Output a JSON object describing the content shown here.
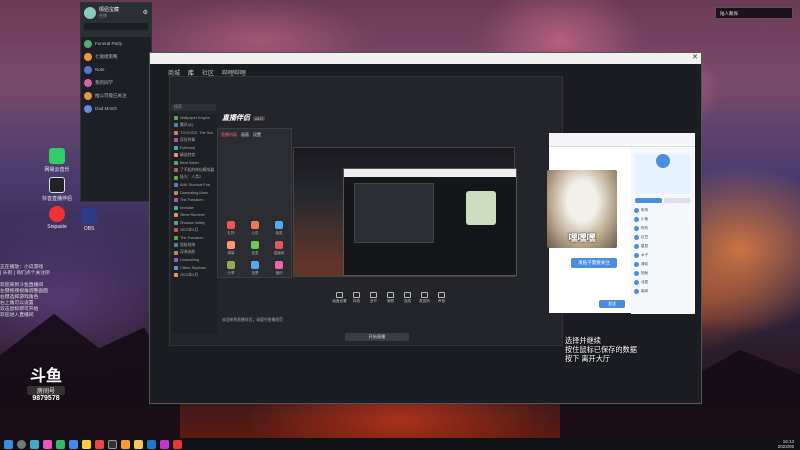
{
  "desktop": {
    "top_right_badge": "陆人聚探",
    "icons": [
      {
        "label": "网易云音乐",
        "color": "#3c6"
      },
      {
        "label": "抖音直播伴侣",
        "color": "#222"
      },
      {
        "label": "Snipaste",
        "color": "#e33"
      },
      {
        "label": "OBS",
        "color": "#2a3c8a"
      }
    ]
  },
  "qq_panel": {
    "user": "情侣宝藏",
    "status": "在线",
    "groups": [
      {
        "name": "Funeral Party"
      },
      {
        "name": "七滋组策略"
      },
      {
        "name": "Note"
      },
      {
        "name": "我的同学"
      },
      {
        "name": "推公可能已关注"
      },
      {
        "name": "Dad Month"
      }
    ]
  },
  "app": {
    "nav": [
      "商城",
      "库",
      "社区",
      "哔哩哔哩"
    ],
    "search_placeholder": "搜索",
    "home_label": "主页",
    "games": [
      "Wallpaper Engine",
      "腾讯QQ",
      "TCHOICE: The Sco",
      "异形终章",
      "Evilnessl",
      "精选特卖",
      "Beat Saber",
      "了不起的修仙模拟器",
      "极光：人类2",
      "AIM: Survival Fort",
      "Damnating Mars",
      "The Forsaken",
      "Invisible",
      "Slime Rancher",
      "Shadow Valley",
      "2023年5月",
      "The Forsaken",
      "诡秘地海",
      "深海迷航",
      "Unravelling",
      "Cities: Skylines",
      "2023年5月"
    ],
    "streaming_tool": {
      "logo": "直播伴侣",
      "version": "v4.0",
      "tabs": [
        "直播内容",
        "画面",
        "设置"
      ],
      "tools": [
        {
          "label": "礼物"
        },
        {
          "label": "公告"
        },
        {
          "label": "抽奖"
        },
        {
          "label": "弹幕"
        },
        {
          "label": "连麦"
        },
        {
          "label": "直播间"
        },
        {
          "label": "分享"
        },
        {
          "label": "投票"
        },
        {
          "label": "福利"
        }
      ],
      "bottom_controls": [
        "画面设置",
        "特效",
        "多开",
        "美颜",
        "连线",
        "麦克风",
        "声音"
      ],
      "start_button": "开始直播",
      "notice": "欢迎来到直播伴侣，请遵守直播规范"
    },
    "chat": {
      "caption": "嘿嘿嘿",
      "follow_button": "发贴子需要关注",
      "send_button": "发送",
      "users": [
        "听风",
        "小鱼",
        "阿布",
        "红豆",
        "星辰",
        "木子",
        "清欢",
        "知秋",
        "北辰",
        "南风"
      ]
    }
  },
  "overlay": {
    "left_lines": [
      "正在播放：小瓜游戏",
      "[ 头衔 ] 哥们点个关注呗",
      "",
      "欢迎来到斗鱼直播间",
      "左键拖拽视角调整画面",
      "右键选择游戏角色",
      "右上角可以设置",
      "双击鼠标即可开始",
      "欢迎进入直播间"
    ],
    "right_lines": [
      "选择并继续",
      "按住鼠标已保存的数据",
      "按下 离开大厅"
    ],
    "douyu_logo": "斗鱼",
    "room_label": "房间号",
    "room_id": "9879578"
  },
  "taskbar": {
    "time": "16:13",
    "date": "2023/05"
  }
}
